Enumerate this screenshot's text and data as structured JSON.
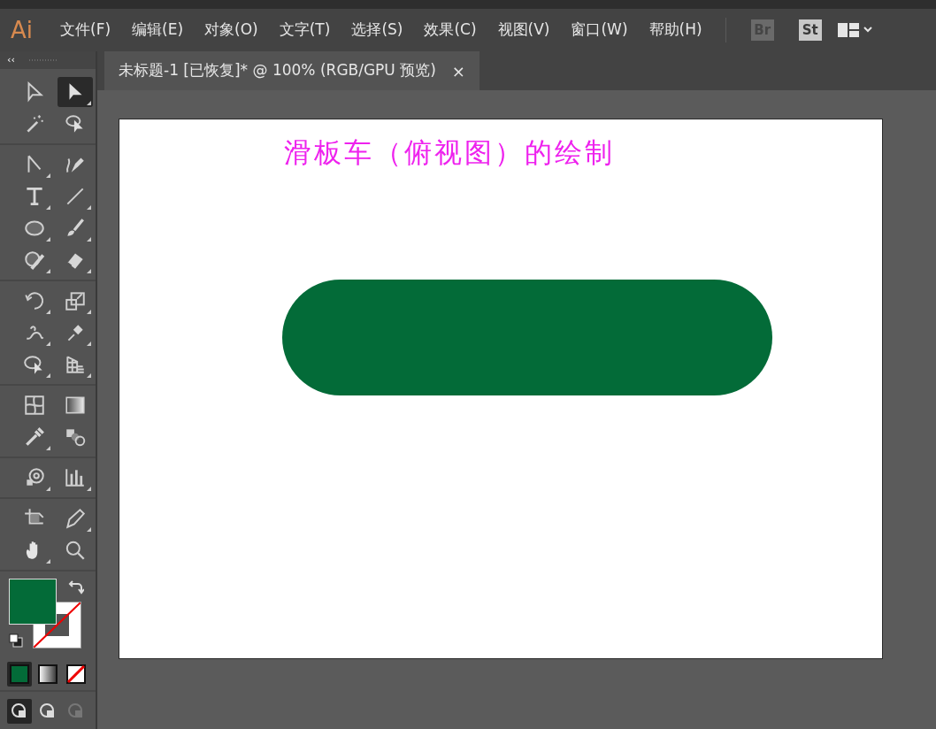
{
  "app": {
    "logo": "Ai"
  },
  "menu": [
    "文件(F)",
    "编辑(E)",
    "对象(O)",
    "文字(T)",
    "选择(S)",
    "效果(C)",
    "视图(V)",
    "窗口(W)",
    "帮助(H)"
  ],
  "bridge_buttons": [
    {
      "label": "Br",
      "disabled": true
    },
    {
      "label": "St",
      "disabled": false
    }
  ],
  "panel": {
    "collapse": "‹‹"
  },
  "document_tab": {
    "title": "未标题-1 [已恢复]* @ 100% (RGB/GPU 预览)",
    "close": "×",
    "selected": true
  },
  "tool_groups": [
    [
      {
        "selected": false,
        "flyout": false
      },
      {
        "selected": true,
        "flyout": true
      },
      {
        "selected": false,
        "flyout": false
      },
      {
        "selected": false,
        "flyout": false
      }
    ],
    [
      {
        "selected": false,
        "flyout": true
      },
      {
        "selected": false,
        "flyout": false
      },
      {
        "selected": false,
        "flyout": true
      },
      {
        "selected": false,
        "flyout": true
      },
      {
        "selected": false,
        "flyout": true
      },
      {
        "selected": false,
        "flyout": true
      },
      {
        "selected": false,
        "flyout": true
      },
      {
        "selected": false,
        "flyout": true
      }
    ],
    [
      {
        "selected": false,
        "flyout": true
      },
      {
        "selected": false,
        "flyout": true
      },
      {
        "selected": false,
        "flyout": true
      },
      {
        "selected": false,
        "flyout": true
      },
      {
        "selected": false,
        "flyout": true
      },
      {
        "selected": false,
        "flyout": true
      }
    ],
    [
      {
        "selected": false,
        "flyout": false
      },
      {
        "selected": false,
        "flyout": false
      },
      {
        "selected": false,
        "flyout": true
      },
      {
        "selected": false,
        "flyout": false
      }
    ],
    [
      {
        "selected": false,
        "flyout": true
      },
      {
        "selected": false,
        "flyout": true
      }
    ],
    [
      {
        "selected": false,
        "flyout": false
      },
      {
        "selected": false,
        "flyout": true
      },
      {
        "selected": false,
        "flyout": true
      },
      {
        "selected": false,
        "flyout": false
      }
    ]
  ],
  "fill": {
    "color": "#036b38"
  },
  "stroke": {
    "kind": "none"
  },
  "color_modes": [
    {
      "kind": "color",
      "selected": true
    },
    {
      "kind": "gradient",
      "selected": false
    },
    {
      "kind": "none",
      "selected": false
    }
  ],
  "draw_modes": [
    {
      "selected": true,
      "disabled": false
    },
    {
      "selected": false,
      "disabled": false
    },
    {
      "selected": false,
      "disabled": true
    }
  ],
  "artboard": {
    "title": "滑板车（俯视图）的绘制",
    "shape": {
      "color": "#036b38"
    }
  }
}
